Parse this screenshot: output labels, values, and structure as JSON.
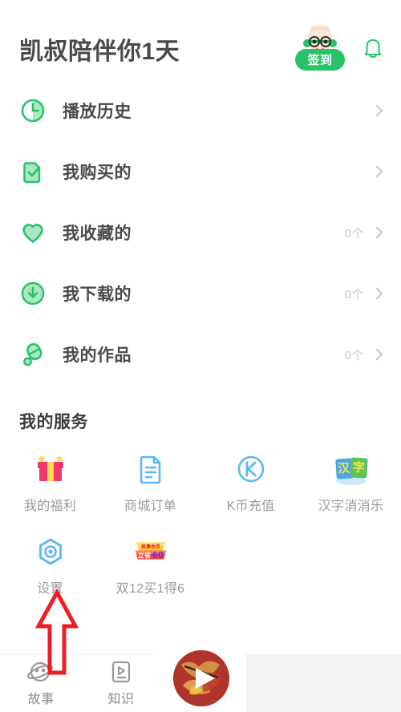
{
  "header": {
    "title": "凯叔陪伴你1天",
    "signin_label": "签到",
    "avatar_icon": "uncle-character-avatar",
    "bell_icon": "bell-icon"
  },
  "list": {
    "rows": [
      {
        "label": "播放历史",
        "count": "",
        "icon": "clock-icon"
      },
      {
        "label": "我购买的",
        "count": "",
        "icon": "check-document-icon"
      },
      {
        "label": "我收藏的",
        "count": "0个",
        "icon": "heart-icon"
      },
      {
        "label": "我下载的",
        "count": "0个",
        "icon": "download-icon"
      },
      {
        "label": "我的作品",
        "count": "0个",
        "icon": "microphone-icon"
      }
    ]
  },
  "services": {
    "title": "我的服务",
    "items": [
      {
        "label": "我的福利",
        "icon": "gift-icon"
      },
      {
        "label": "商城订单",
        "icon": "order-document-icon"
      },
      {
        "label": "K币充值",
        "icon": "k-coin-icon"
      },
      {
        "label": "汉字消消乐",
        "icon": "hanzi-game-icon",
        "tile_text": "汉字"
      },
      {
        "label": "设置",
        "icon": "settings-hexagon-icon"
      },
      {
        "label": "双12买1得6",
        "icon": "promo-badge-icon",
        "promo_top": "故事会员",
        "promo_bottom": "立省60"
      }
    ]
  },
  "bottom_nav": {
    "items": [
      {
        "label": "故事",
        "icon": "planet-icon"
      },
      {
        "label": "知识",
        "icon": "play-box-icon"
      }
    ],
    "play_button_icon": "play-triangle-icon"
  },
  "annotation": {
    "arrow_icon": "up-arrow-annotation",
    "color": "#ee1c25"
  },
  "colors": {
    "green": "#27c367",
    "green_light": "#a9e8c3",
    "blue": "#5bb8f5",
    "pink": "#f5356e",
    "yellow": "#ffd84d",
    "text_dark": "#4a4a4a",
    "text_gray": "#9a9a9a",
    "text_light": "#c6c6c6"
  }
}
